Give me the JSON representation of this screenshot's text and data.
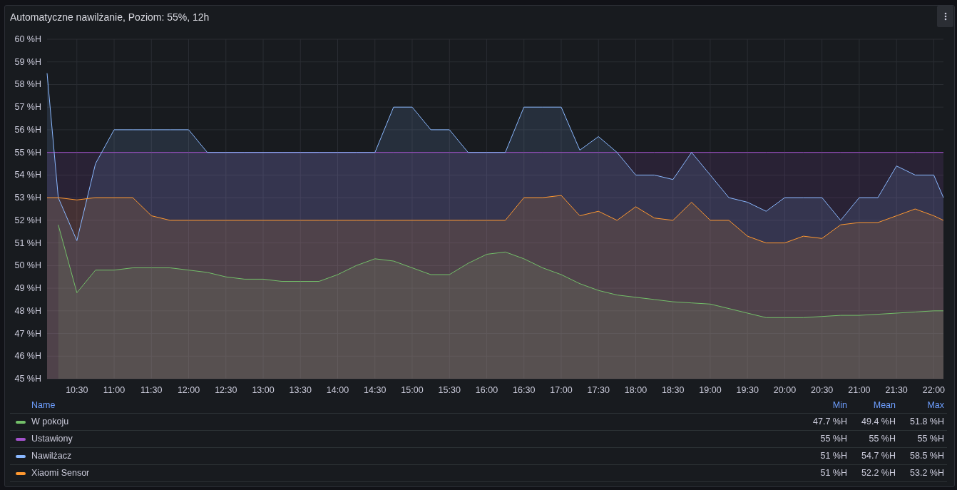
{
  "panel": {
    "title": "Automatyczne nawilżanie, Poziom: 55%, 12h",
    "chart_data": {
      "type": "area",
      "grid": true,
      "x": [
        10.1,
        10.25,
        10.5,
        10.75,
        11,
        11.25,
        11.5,
        11.75,
        12,
        12.25,
        12.5,
        12.75,
        13,
        13.25,
        13.5,
        13.75,
        14,
        14.25,
        14.5,
        14.75,
        15,
        15.25,
        15.5,
        15.75,
        16,
        16.25,
        16.5,
        16.75,
        17,
        17.25,
        17.5,
        17.75,
        18,
        18.25,
        18.5,
        18.75,
        19,
        19.25,
        19.5,
        19.75,
        20,
        20.25,
        20.5,
        20.75,
        21,
        21.25,
        21.5,
        21.75,
        22,
        22.13
      ],
      "xlim": [
        10.1,
        22.13
      ],
      "ylim": [
        45,
        60
      ],
      "xticks": [
        {
          "value": 10.5,
          "label": "10:30"
        },
        {
          "value": 11,
          "label": "11:00"
        },
        {
          "value": 11.5,
          "label": "11:30"
        },
        {
          "value": 12,
          "label": "12:00"
        },
        {
          "value": 12.5,
          "label": "12:30"
        },
        {
          "value": 13,
          "label": "13:00"
        },
        {
          "value": 13.5,
          "label": "13:30"
        },
        {
          "value": 14,
          "label": "14:00"
        },
        {
          "value": 14.5,
          "label": "14:30"
        },
        {
          "value": 15,
          "label": "15:00"
        },
        {
          "value": 15.5,
          "label": "15:30"
        },
        {
          "value": 16,
          "label": "16:00"
        },
        {
          "value": 16.5,
          "label": "16:30"
        },
        {
          "value": 17,
          "label": "17:00"
        },
        {
          "value": 17.5,
          "label": "17:30"
        },
        {
          "value": 18,
          "label": "18:00"
        },
        {
          "value": 18.5,
          "label": "18:30"
        },
        {
          "value": 19,
          "label": "19:00"
        },
        {
          "value": 19.5,
          "label": "19:30"
        },
        {
          "value": 20,
          "label": "20:00"
        },
        {
          "value": 20.5,
          "label": "20:30"
        },
        {
          "value": 21,
          "label": "21:00"
        },
        {
          "value": 21.5,
          "label": "21:30"
        },
        {
          "value": 22,
          "label": "22:00"
        }
      ],
      "yticks": [
        {
          "value": 60,
          "label": "60 %H"
        },
        {
          "value": 59,
          "label": "59 %H"
        },
        {
          "value": 58,
          "label": "58 %H"
        },
        {
          "value": 57,
          "label": "57 %H"
        },
        {
          "value": 56,
          "label": "56 %H"
        },
        {
          "value": 55,
          "label": "55 %H"
        },
        {
          "value": 54,
          "label": "54 %H"
        },
        {
          "value": 53,
          "label": "53 %H"
        },
        {
          "value": 52,
          "label": "52 %H"
        },
        {
          "value": 51,
          "label": "51 %H"
        },
        {
          "value": 50,
          "label": "50 %H"
        },
        {
          "value": 49,
          "label": "49 %H"
        },
        {
          "value": 48,
          "label": "48 %H"
        },
        {
          "value": 47,
          "label": "47 %H"
        },
        {
          "value": 46,
          "label": "46 %H"
        },
        {
          "value": 45,
          "label": "45 %H"
        }
      ],
      "series": [
        {
          "name": "W pokoju",
          "color": "#73bf69",
          "values": [
            null,
            51.8,
            48.8,
            49.8,
            49.8,
            49.9,
            49.9,
            49.9,
            49.8,
            49.7,
            49.5,
            49.4,
            49.4,
            49.3,
            49.3,
            49.3,
            49.6,
            50,
            50.3,
            50.2,
            49.9,
            49.6,
            49.6,
            50.1,
            50.5,
            50.6,
            50.3,
            49.9,
            49.6,
            49.2,
            48.9,
            48.7,
            48.6,
            48.5,
            48.4,
            48.35,
            48.3,
            48.1,
            47.9,
            47.7,
            47.7,
            47.7,
            47.75,
            47.8,
            47.8,
            47.85,
            47.9,
            47.95,
            48,
            48
          ]
        },
        {
          "name": "Ustawiony",
          "color": "#a352cc",
          "values": [
            55,
            55,
            55,
            55,
            55,
            55,
            55,
            55,
            55,
            55,
            55,
            55,
            55,
            55,
            55,
            55,
            55,
            55,
            55,
            55,
            55,
            55,
            55,
            55,
            55,
            55,
            55,
            55,
            55,
            55,
            55,
            55,
            55,
            55,
            55,
            55,
            55,
            55,
            55,
            55,
            55,
            55,
            55,
            55,
            55,
            55,
            55,
            55,
            55,
            55
          ]
        },
        {
          "name": "Nawilżacz",
          "color": "#8ab8ff",
          "values": [
            58.5,
            53,
            51.1,
            54.5,
            56,
            56,
            56,
            56,
            56,
            55,
            55,
            55,
            55,
            55,
            55,
            55,
            55,
            55,
            55,
            57,
            57,
            56,
            56,
            55,
            55,
            55,
            57,
            57,
            57,
            55.1,
            55.7,
            55,
            54,
            54,
            53.8,
            55,
            54,
            53,
            52.8,
            52.4,
            53,
            53,
            53,
            52,
            53,
            53,
            54.4,
            54,
            54,
            53
          ]
        },
        {
          "name": "Xiaomi Sensor",
          "color": "#ff9830",
          "values": [
            53,
            53,
            52.9,
            53,
            53,
            53,
            52.2,
            52,
            52,
            52,
            52,
            52,
            52,
            52,
            52,
            52,
            52,
            52,
            52,
            52,
            52,
            52,
            52,
            52,
            52,
            52,
            53,
            53,
            53.1,
            52.2,
            52.4,
            52,
            52.6,
            52.1,
            52,
            52.8,
            52,
            52,
            51.3,
            51,
            51,
            51.3,
            51.2,
            51.8,
            51.9,
            51.9,
            52.2,
            52.5,
            52.2,
            52
          ]
        }
      ]
    }
  },
  "legend": {
    "columns": [
      "Name",
      "Min",
      "Mean",
      "Max"
    ],
    "rows": [
      {
        "min": "47.7 %H",
        "mean": "49.4 %H",
        "max": "51.8 %H"
      },
      {
        "min": "55 %H",
        "mean": "55 %H",
        "max": "55 %H"
      },
      {
        "min": "51 %H",
        "mean": "54.7 %H",
        "max": "58.5 %H"
      },
      {
        "min": "51 %H",
        "mean": "52.2 %H",
        "max": "53.2 %H"
      }
    ]
  }
}
